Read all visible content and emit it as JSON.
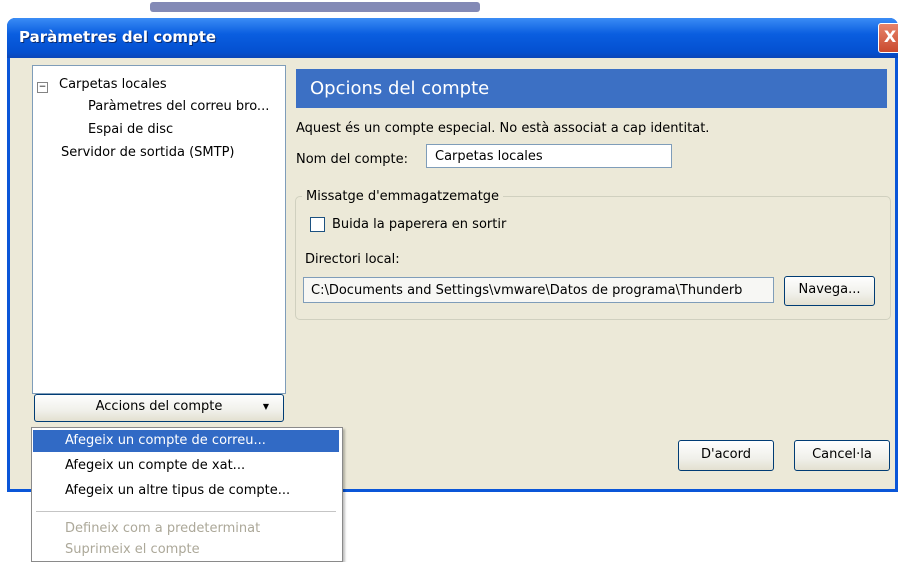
{
  "window": {
    "title": "Paràmetres del compte",
    "close_symbol": "X"
  },
  "tree": {
    "items": [
      "Carpetas locales",
      "Paràmetres del correu bro...",
      "Espai de disc",
      "Servidor de sortida (SMTP)"
    ],
    "expander": "−"
  },
  "actions": {
    "label": "Accions del compte",
    "arrow": "▼"
  },
  "panel": {
    "header": "Opcions del compte",
    "info": "Aquest és un compte especial. No està associat a cap identitat.",
    "name_label": "Nom del compte:",
    "name_value": "Carpetas locales",
    "group_label": "Missatge d'emmagatzematge",
    "checkbox_label": "Buida la paperera en sortir",
    "checkbox_checked": false,
    "dir_label": "Directori local:",
    "dir_value": "C:\\Documents and Settings\\vmware\\Datos de programa\\Thunderb",
    "browse_label": "Navega..."
  },
  "buttons": {
    "ok": "D'acord",
    "cancel": "Cancel·la"
  },
  "menu": {
    "items": [
      "Afegeix un compte de correu...",
      "Afegeix un compte de xat...",
      "Afegeix un altre tipus de compte...",
      "Defineix com a predeterminat",
      "Suprimeix el compte"
    ]
  },
  "colors": {
    "title_bar": "#0a5ee0",
    "header_bar": "#3c70c4",
    "highlight": "#316ac5",
    "client_bg": "#ece9d8"
  }
}
